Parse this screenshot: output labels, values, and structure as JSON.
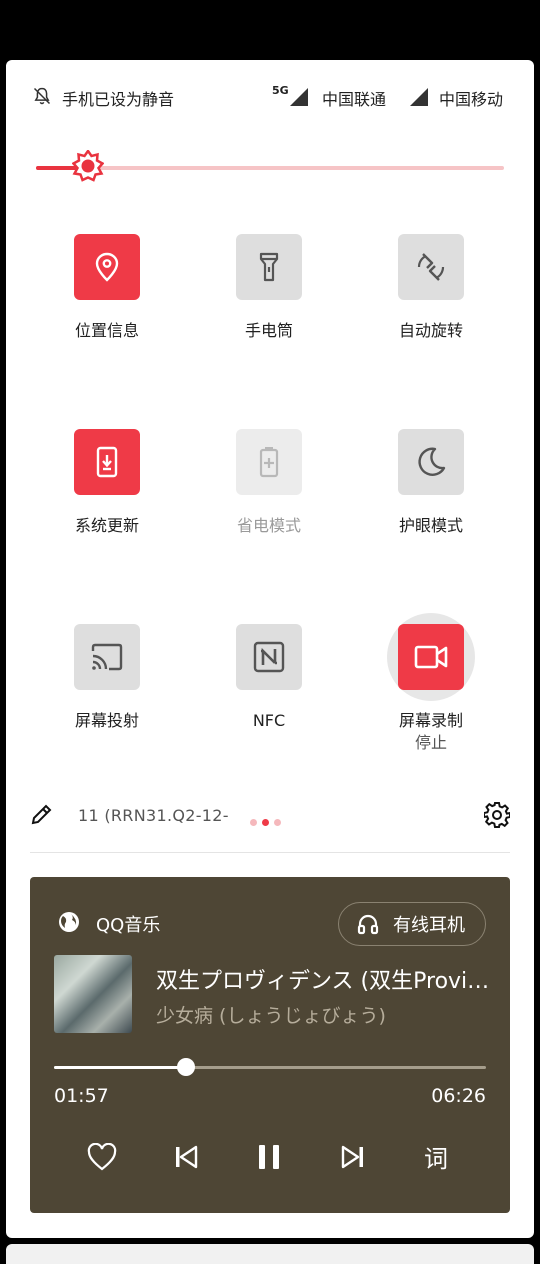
{
  "status": {
    "mute_text": "手机已设为静音",
    "network_badge": "5G",
    "carrier1": "中国联通",
    "carrier2": "中国移动"
  },
  "brightness": {
    "level": 0.11
  },
  "tiles": [
    {
      "label": "位置信息",
      "icon": "location-icon",
      "state": "on"
    },
    {
      "label": "手电筒",
      "icon": "flashlight-icon",
      "state": "off"
    },
    {
      "label": "自动旋转",
      "icon": "rotate-icon",
      "state": "off"
    },
    {
      "label": "系统更新",
      "icon": "system-update-icon",
      "state": "on"
    },
    {
      "label": "省电模式",
      "icon": "battery-saver-icon",
      "state": "disabled"
    },
    {
      "label": "护眼模式",
      "icon": "moon-icon",
      "state": "off"
    },
    {
      "label": "屏幕投射",
      "icon": "cast-icon",
      "state": "off"
    },
    {
      "label": "NFC",
      "icon": "nfc-icon",
      "state": "off"
    },
    {
      "label": "屏幕录制",
      "sub": "停止",
      "icon": "video-camera-icon",
      "state": "on"
    }
  ],
  "footer": {
    "build": "11 (RRN31.Q2-12-",
    "page_count": 3,
    "active_page": 1
  },
  "music": {
    "app": "QQ音乐",
    "device": "有线耳机",
    "song": "双生プロヴィデンス (双生Providence)",
    "artist": "少女病 (しょうじょびょう)",
    "current_time": "01:57",
    "total_time": "06:26",
    "progress": 0.305,
    "lyrics_label": "词"
  },
  "colors": {
    "accent": "#ef3a47",
    "tile_off": "#dedede",
    "music_bg": "#4e4635"
  }
}
